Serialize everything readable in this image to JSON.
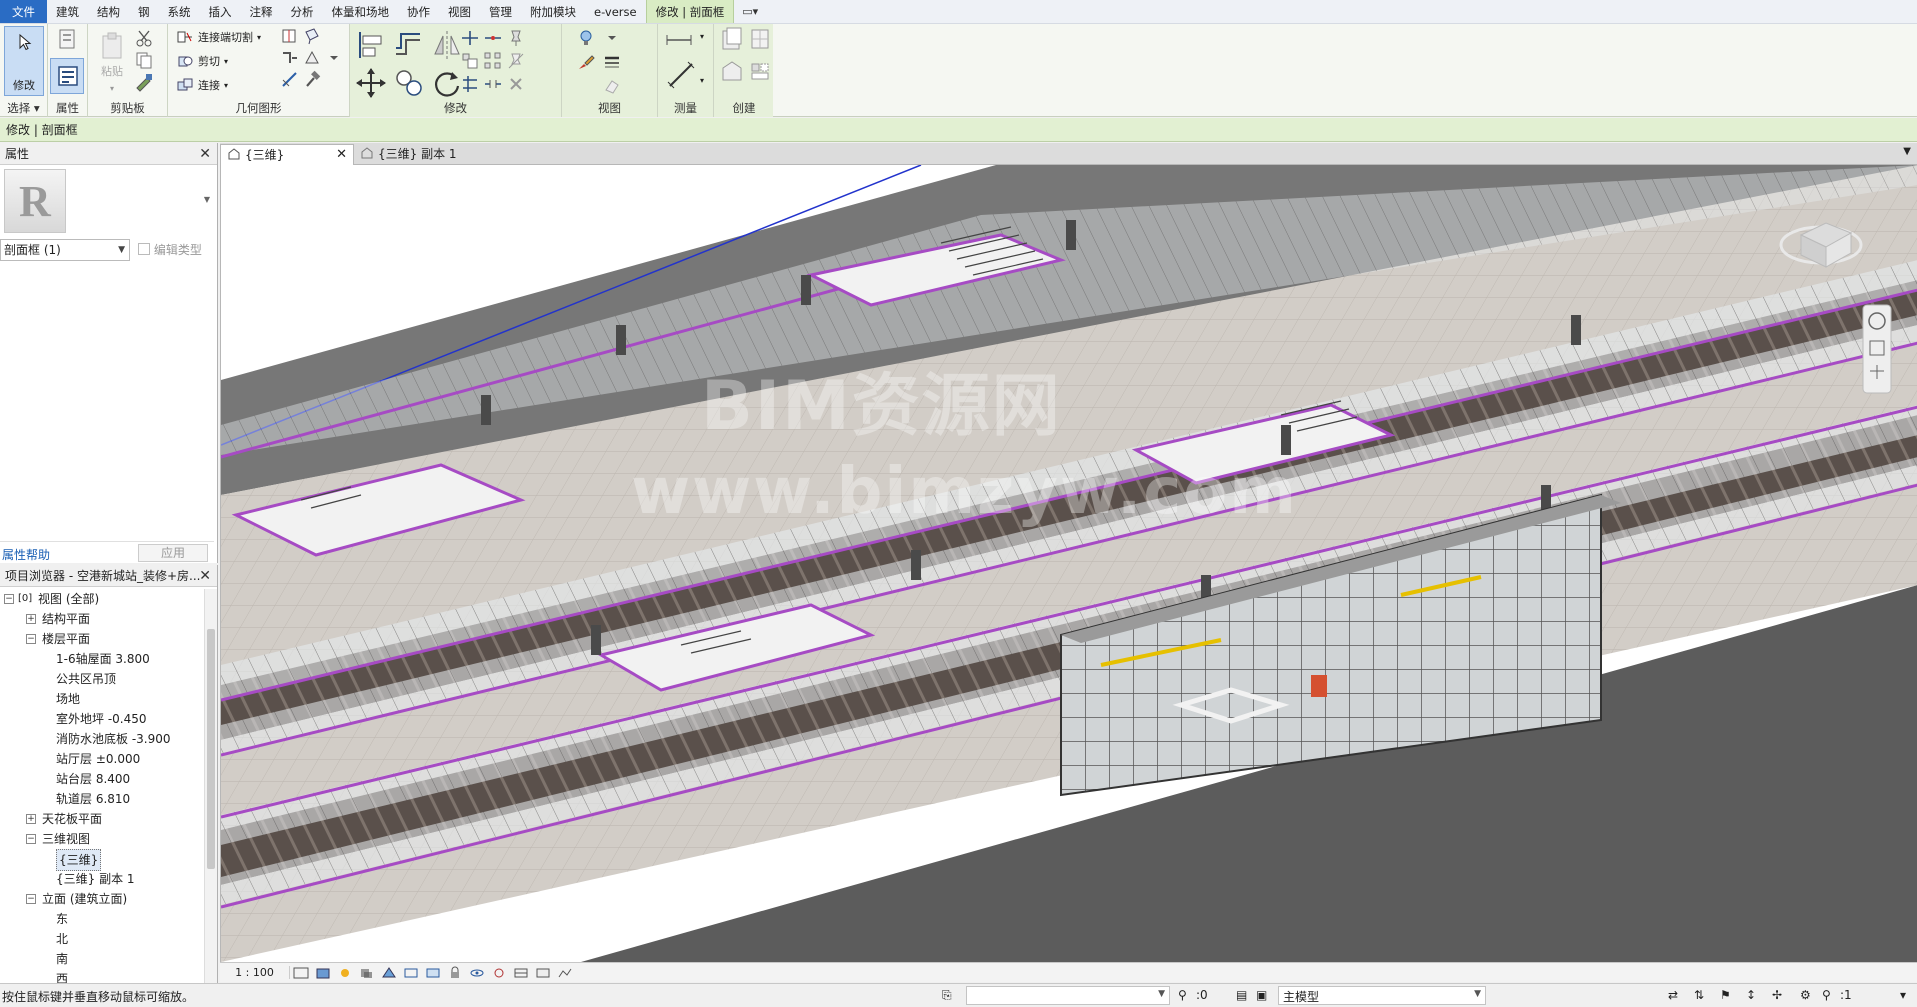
{
  "menu": {
    "items": [
      {
        "label": "文件",
        "kind": "file"
      },
      {
        "label": "建筑"
      },
      {
        "label": "结构"
      },
      {
        "label": "钢"
      },
      {
        "label": "系统"
      },
      {
        "label": "插入"
      },
      {
        "label": "注释"
      },
      {
        "label": "分析"
      },
      {
        "label": "体量和场地"
      },
      {
        "label": "协作"
      },
      {
        "label": "视图"
      },
      {
        "label": "管理"
      },
      {
        "label": "附加模块"
      },
      {
        "label": "e-verse"
      },
      {
        "label": "修改 | 剖面框",
        "kind": "active"
      }
    ],
    "extra": "▭▾"
  },
  "ribbon": {
    "select": {
      "modify_label": "修改",
      "panel_label": "选择 ▾"
    },
    "properties": {
      "panel_label": "属性"
    },
    "clipboard": {
      "paste_label": "粘贴",
      "panel_label": "剪贴板"
    },
    "geometry": {
      "cope_label": "连接端切割",
      "cut_label": "剪切",
      "join_label": "连接",
      "panel_label": "几何图形"
    },
    "modify": {
      "panel_label": "修改"
    },
    "view": {
      "panel_label": "视图"
    },
    "measure": {
      "panel_label": "测量"
    },
    "create": {
      "panel_label": "创建"
    }
  },
  "context_bar": {
    "text": "修改 | 剖面框"
  },
  "properties_panel": {
    "title": "属性",
    "instance_selector": "剖面框 (1)",
    "edit_type": "编辑类型",
    "help_link": "属性帮助",
    "apply_button": "应用"
  },
  "project_browser": {
    "title": "项目浏览器 - 空港新城站_装修+房...",
    "nodes": [
      {
        "label": "视图 (全部)",
        "level": 0,
        "toggle": "−",
        "icon": "[0]"
      },
      {
        "label": "结构平面",
        "level": 1,
        "toggle": "+"
      },
      {
        "label": "楼层平面",
        "level": 1,
        "toggle": "−"
      },
      {
        "label": "1-6轴屋面 3.800",
        "level": 2
      },
      {
        "label": "公共区吊顶",
        "level": 2
      },
      {
        "label": "场地",
        "level": 2
      },
      {
        "label": "室外地坪 -0.450",
        "level": 2
      },
      {
        "label": "消防水池底板 -3.900",
        "level": 2
      },
      {
        "label": "站厅层 ±0.000",
        "level": 2
      },
      {
        "label": "站台层 8.400",
        "level": 2
      },
      {
        "label": "轨道层 6.810",
        "level": 2
      },
      {
        "label": "天花板平面",
        "level": 1,
        "toggle": "+"
      },
      {
        "label": "三维视图",
        "level": 1,
        "toggle": "−"
      },
      {
        "label": "{三维}",
        "level": 2,
        "selected": true
      },
      {
        "label": "{三维} 副本 1",
        "level": 2
      },
      {
        "label": "立面 (建筑立面)",
        "level": 1,
        "toggle": "−"
      },
      {
        "label": "东",
        "level": 2
      },
      {
        "label": "北",
        "level": 2
      },
      {
        "label": "南",
        "level": 2
      },
      {
        "label": "西",
        "level": 2
      }
    ]
  },
  "tabs": [
    {
      "label": "{三维}",
      "active": true,
      "close": "✕"
    },
    {
      "label": "{三维} 副本 1",
      "active": false
    }
  ],
  "viewport": {
    "watermark_1": "BIM资源网",
    "watermark_2": "www.bimzyw.com",
    "colors": {
      "floor": "#cfcac4",
      "track": "#5d5450",
      "wall": "#6e6e6e",
      "highlight": "#a64bc4",
      "glass": "#dfe4e6"
    }
  },
  "view_control_bar": {
    "scale": "1 : 100"
  },
  "status_bar": {
    "message": "按住鼠标键并垂直移动鼠标可缩放。",
    "coord_count": ":0",
    "model_field": "主模型",
    "filter_count": ":1"
  }
}
